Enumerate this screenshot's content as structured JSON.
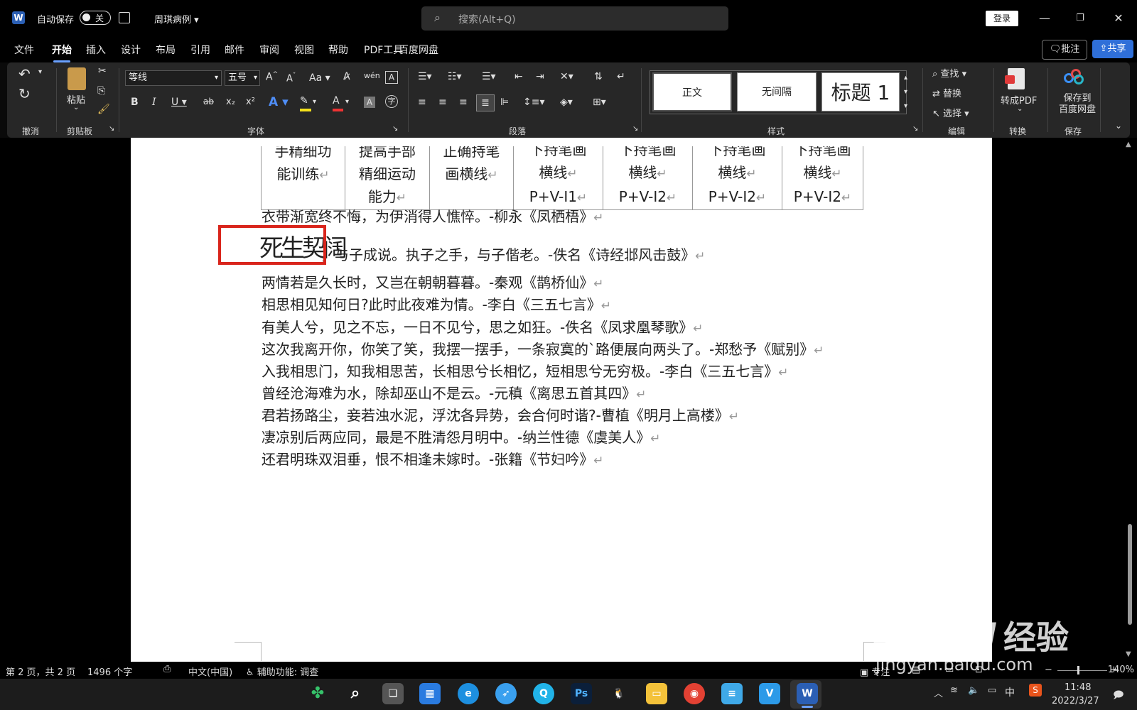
{
  "titlebar": {
    "app_letter": "W",
    "autosave_label": "自动保存",
    "autosave_state": "关",
    "doc_name": "周琪病例",
    "search_placeholder": "搜索(Alt+Q)",
    "login_label": "登录"
  },
  "menu": {
    "tabs": [
      "文件",
      "开始",
      "插入",
      "设计",
      "布局",
      "引用",
      "邮件",
      "审阅",
      "视图",
      "帮助",
      "PDF工具",
      "百度网盘"
    ],
    "active": "开始",
    "comment_label": "批注",
    "share_label": "共享"
  },
  "ribbon": {
    "groups": {
      "undo": "撤消",
      "clipboard": "剪贴板",
      "font": "字体",
      "paragraph": "段落",
      "styles": "样式",
      "editing": "编辑",
      "convert": "转换",
      "save": "保存"
    },
    "paste_label": "粘贴",
    "font_name": "等线",
    "font_size": "五号",
    "styles": [
      "正文",
      "无间隔",
      "标题 1"
    ],
    "find_label": "查找",
    "replace_label": "替换",
    "select_label": "选择",
    "to_pdf_label": "转成PDF",
    "save_baidu_label1": "保存到",
    "save_baidu_label2": "百度网盘"
  },
  "table": {
    "row_lines": [
      [
        "手精细功",
        "能训练"
      ],
      [
        "提高手部",
        "精细运动",
        "能力"
      ],
      [
        "正确持笔",
        "画横线"
      ],
      [
        "下持笔画",
        "横线",
        "P+V-I1"
      ],
      [
        "下持笔画",
        "横线",
        "P+V-I2"
      ],
      [
        "下持笔画",
        "横线",
        "P+V-I2"
      ],
      [
        "下持笔画",
        "横线",
        "P+V-I2"
      ]
    ]
  },
  "doc": {
    "lines": [
      "衣带渐宽终不悔，为伊消得人憔悴。-柳永《凤栖梧》",
      "，与子成说。执子之手，与子偕老。-佚名《诗经邶风击鼓》",
      "两情若是久长时，又岂在朝朝暮暮。-秦观《鹊桥仙》",
      "相思相见知何日?此时此夜难为情。-李白《三五七言》",
      "有美人兮，见之不忘，一日不见兮，思之如狂。-佚名《凤求凰琴歌》",
      "这次我离开你，你笑了笑，我摆一摆手，一条寂寞的`路便展向两头了。-郑愁予《赋别》",
      "入我相思门，知我相思苦，长相思兮长相忆，短相思兮无穷极。-李白《三五七言》",
      "曾经沧海难为水，除却巫山不是云。-元稹《离思五首其四》",
      "君若扬路尘，妾若浊水泥，浮沈各异势，会合何时谐?-曹植《明月上高楼》",
      "凄凉别后两应同，最是不胜清怨月明中。-纳兰性德《虞美人》",
      "还君明珠双泪垂，恨不相逢未嫁时。-张籍《节妇吟》"
    ],
    "seal_text": "死生契阔"
  },
  "status": {
    "page": "第 2 页，共 2 页",
    "words": "1496 个字",
    "lang": "中文(中国)",
    "access": "辅助功能: 调查",
    "focus": "专注",
    "zoom": "140%"
  },
  "taskbar": {
    "time": "11:48",
    "date": "2022/3/27",
    "ime": "中"
  },
  "watermark": {
    "brand": "Baidu",
    "cn": "经验",
    "url": "jingyan.baidu.com"
  }
}
